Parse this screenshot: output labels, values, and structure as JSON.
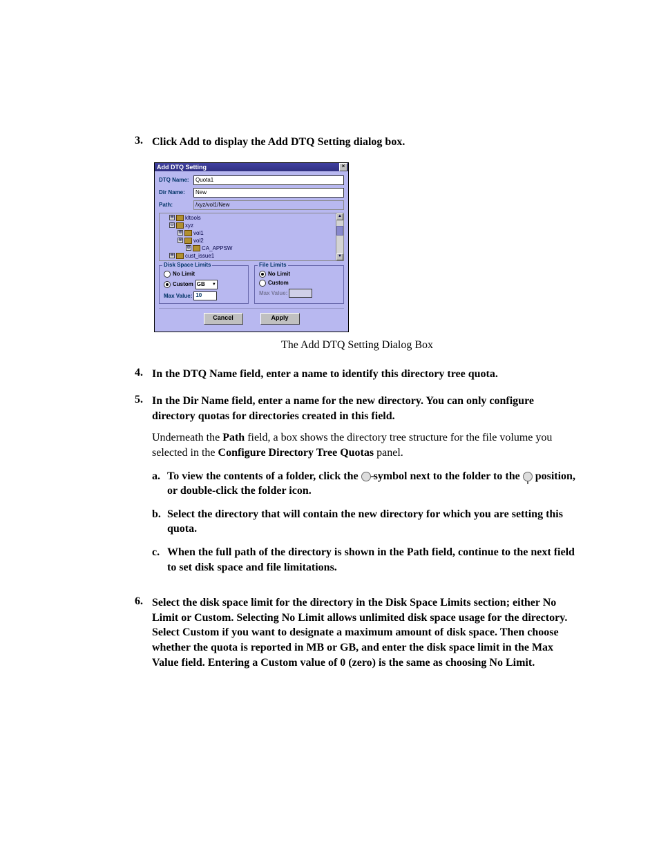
{
  "steps": {
    "s3": {
      "num": "3.",
      "text": "Click Add to display the Add DTQ Setting dialog box."
    },
    "s4": {
      "num": "4.",
      "text": "In the DTQ Name field, enter a name to identify this directory tree quota."
    },
    "s5": {
      "num": "5.",
      "text": "In the Dir Name field, enter a name for the new directory. You can only configure directory quotas for directories created in this field.",
      "para_pre": "Underneath the ",
      "para_bold1": "Path",
      "para_mid": " field, a box shows the directory tree structure for the file volume you selected in the ",
      "para_bold2": "Configure Directory Tree Quotas",
      "para_post": " panel.",
      "a": {
        "lbl": "a.",
        "pre": "To view the contents of a folder, click the ",
        "mid": " symbol next to the folder to the ",
        "post": " position, or double-click the folder icon."
      },
      "b": {
        "lbl": "b.",
        "text": "Select the directory that will contain the new directory for which you are setting this quota."
      },
      "c": {
        "lbl": "c.",
        "text": "When the full path of the directory is shown in the Path field, continue to the next field to set disk space and file limitations."
      }
    },
    "s6": {
      "num": "6.",
      "text": "Select the disk space limit for the directory in the Disk Space Limits section; either No Limit or Custom. Selecting No Limit allows unlimited disk space usage for the directory. Select Custom if you want to designate a maximum amount of disk space. Then choose whether the quota is reported in MB or GB, and enter the disk space limit in the Max Value field. Entering a Custom value of 0 (zero) is the same as choosing No Limit."
    }
  },
  "caption": "The Add DTQ Setting Dialog Box",
  "dialog": {
    "title": "Add DTQ Setting",
    "labels": {
      "dtq_name": "DTQ Name:",
      "dir_name": "Dir Name:",
      "path": "Path:"
    },
    "values": {
      "dtq_name": "Quota1",
      "dir_name": "New",
      "path": "/xyz/vol1/New"
    },
    "tree": {
      "items": [
        {
          "level": 1,
          "toggle": "⊕",
          "label": "kltools"
        },
        {
          "level": 1,
          "toggle": "⊖",
          "label": "xyz"
        },
        {
          "level": 2,
          "toggle": "⊕",
          "label": "vol1"
        },
        {
          "level": 2,
          "toggle": "⊕",
          "label": "vol2"
        },
        {
          "level": 2,
          "toggle": "⊕",
          "label": "CA_APPSW"
        },
        {
          "level": 1,
          "toggle": "⊕",
          "label": "cust_issue1"
        }
      ]
    },
    "disk_space": {
      "legend": "Disk Space Limits",
      "nolimit": "No Limit",
      "custom": "Custom",
      "unit": "GB",
      "max_label": "Max Value:",
      "max_value": "10"
    },
    "file_limits": {
      "legend": "File Limits",
      "nolimit": "No Limit",
      "custom": "Custom",
      "max_label": "Max Value:"
    },
    "buttons": {
      "cancel": "Cancel",
      "apply": "Apply"
    }
  }
}
